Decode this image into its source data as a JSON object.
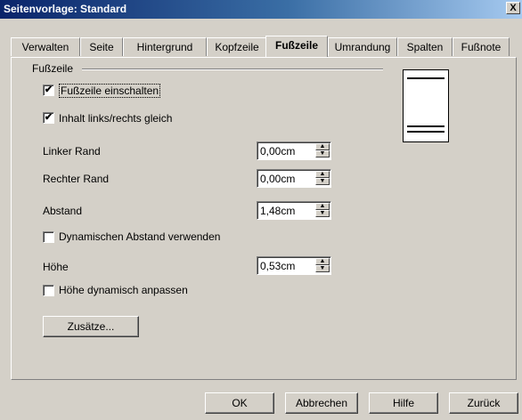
{
  "window": {
    "title": "Seitenvorlage: Standard",
    "close_glyph": "X"
  },
  "tabs": [
    {
      "label": "Verwalten"
    },
    {
      "label": "Seite"
    },
    {
      "label": "Hintergrund"
    },
    {
      "label": "Kopfzeile"
    },
    {
      "label": "Fußzeile",
      "active": true
    },
    {
      "label": "Umrandung"
    },
    {
      "label": "Spalten"
    },
    {
      "label": "Fußnote"
    }
  ],
  "section": {
    "title": "Fußzeile"
  },
  "options": {
    "footer_on": {
      "label": "Fußzeile einschalten",
      "checked": true,
      "mark": "✔"
    },
    "same_content": {
      "label": "Inhalt links/rechts gleich",
      "checked": true,
      "mark": "✔"
    },
    "dynamic_spacing": {
      "label": "Dynamischen Abstand verwenden",
      "checked": false,
      "mark": ""
    },
    "autofit_height": {
      "label": "Höhe dynamisch anpassen",
      "checked": false,
      "mark": ""
    }
  },
  "fields": {
    "left_margin": {
      "label": "Linker Rand",
      "value": "0,00cm"
    },
    "right_margin": {
      "label": "Rechter Rand",
      "value": "0,00cm"
    },
    "spacing": {
      "label": "Abstand",
      "value": "1,48cm"
    },
    "height": {
      "label": "Höhe",
      "value": "0,53cm"
    }
  },
  "buttons": {
    "more": "Zusätze...",
    "ok": "OK",
    "cancel": "Abbrechen",
    "help": "Hilfe",
    "reset": "Zurück"
  },
  "icons": {
    "close": "close-icon",
    "spin_up": "spin-up-icon",
    "spin_down": "spin-down-icon"
  }
}
